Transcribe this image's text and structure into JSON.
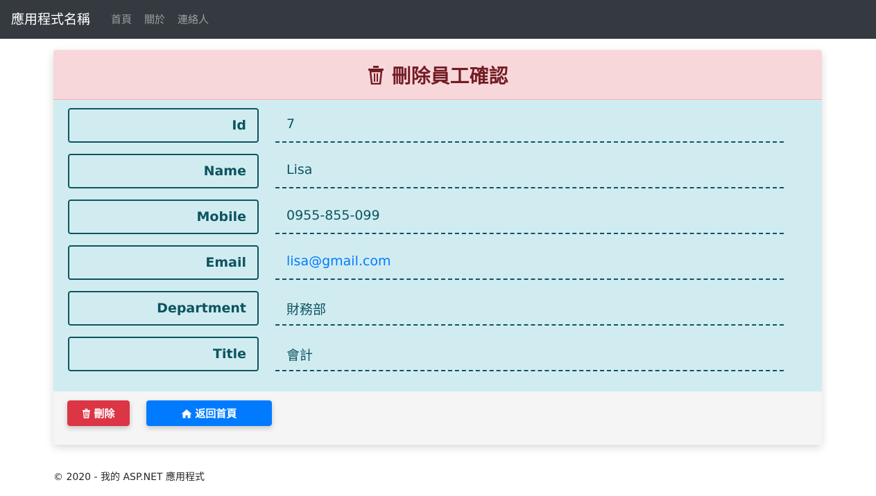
{
  "navbar": {
    "brand": "應用程式名稱",
    "links": [
      "首頁",
      "關於",
      "連絡人"
    ]
  },
  "card": {
    "title": "刪除員工確認",
    "title_icon": "trash-icon",
    "fields": [
      {
        "label": "Id",
        "value": "7"
      },
      {
        "label": "Name",
        "value": "Lisa"
      },
      {
        "label": "Mobile",
        "value": "0955-855-099"
      },
      {
        "label": "Email",
        "value": "lisa@gmail.com"
      },
      {
        "label": "Department",
        "value": "財務部"
      },
      {
        "label": "Title",
        "value": "會計"
      }
    ],
    "delete_button": "刪除",
    "delete_icon": "trash-icon",
    "home_button": "返回首頁",
    "home_icon": "home-icon"
  },
  "footer": {
    "text": "© 2020 - 我的 ASP.NET 應用程式"
  },
  "colors": {
    "navbar_bg": "#343a40",
    "header_bg": "#f8d7da",
    "header_text": "#721c24",
    "body_bg": "#d1ecf1",
    "field_text": "#0c5460",
    "link": "#007bff",
    "danger": "#dc3545",
    "primary": "#007bff"
  }
}
